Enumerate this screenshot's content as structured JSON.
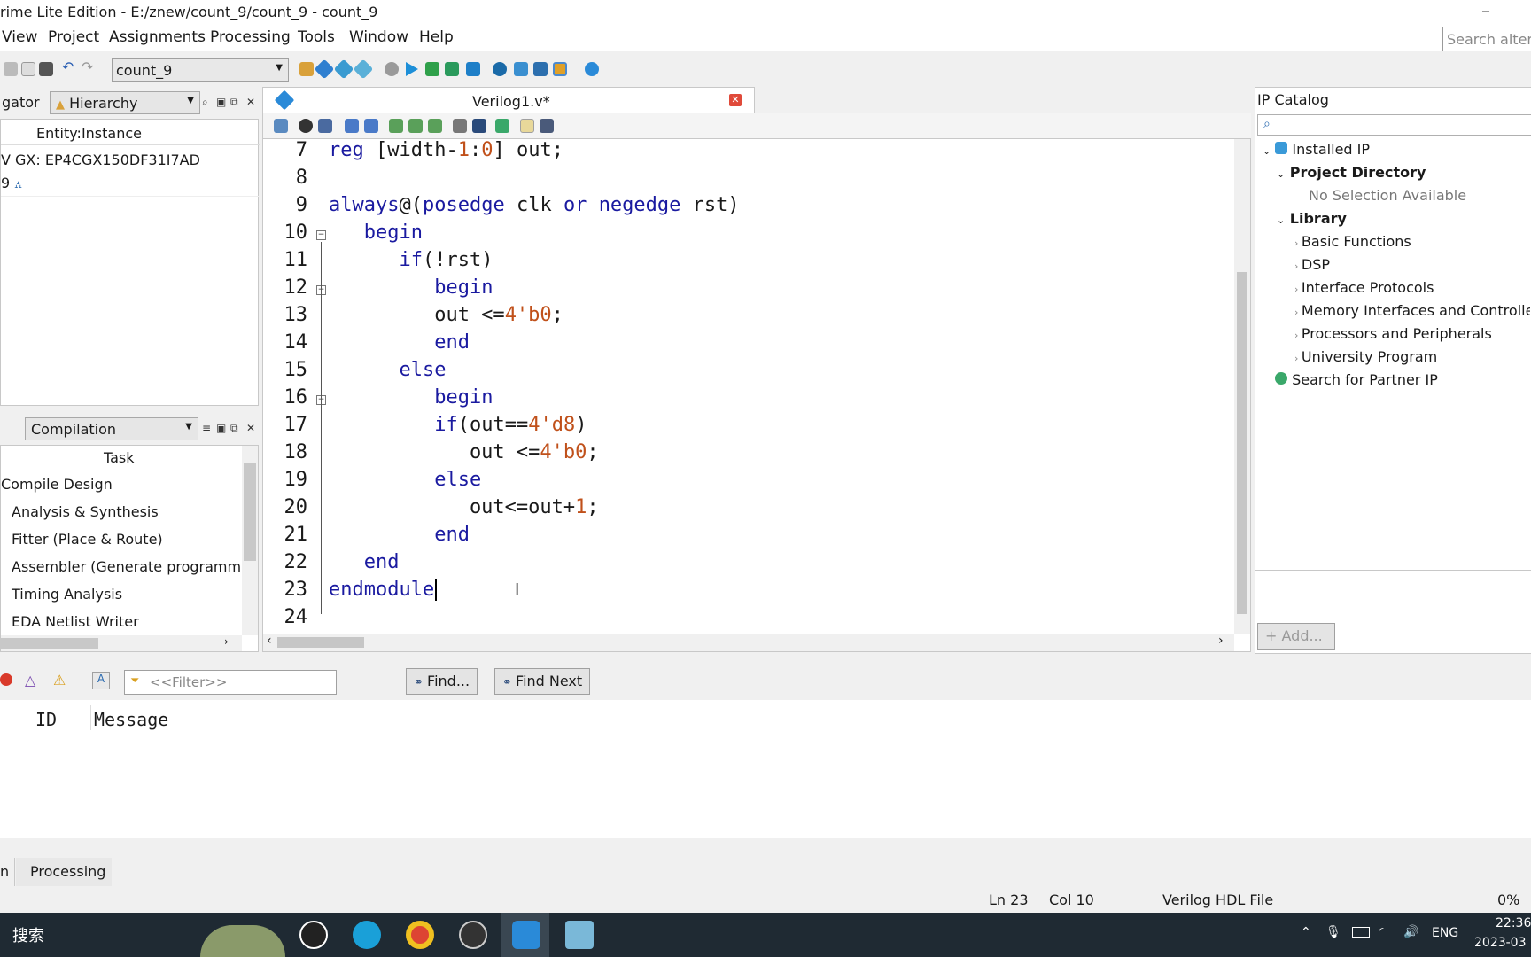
{
  "window": {
    "title": "rime Lite Edition - E:/znew/count_9/count_9 - count_9",
    "minimize_glyph": "–"
  },
  "menu": {
    "items": [
      "View",
      "Project",
      "Assignments",
      "Processing",
      "Tools",
      "Window",
      "Help"
    ]
  },
  "search": {
    "placeholder": "Search altera"
  },
  "toolbar": {
    "project": "count_9"
  },
  "navigator": {
    "tab_label": "gator",
    "view": "Hierarchy",
    "column_header": "Entity:Instance",
    "device": "V GX: EP4CGX150DF31I7AD",
    "entity": "9"
  },
  "tasks": {
    "flow": "Compilation",
    "column_header": "Task",
    "items": [
      "Compile Design",
      "Analysis & Synthesis",
      "Fitter (Place & Route)",
      "Assembler (Generate programmin",
      "Timing Analysis",
      "EDA Netlist Writer"
    ]
  },
  "editor": {
    "tab": "Verilog1.v*",
    "lines": [
      "7",
      "8",
      "9",
      "10",
      "11",
      "12",
      "13",
      "14",
      "15",
      "16",
      "17",
      "18",
      "19",
      "20",
      "21",
      "22",
      "23",
      "24"
    ]
  },
  "ip_catalog": {
    "title": "IP Catalog",
    "installed": "Installed IP",
    "project_dir": "Project Directory",
    "no_selection": "No Selection Available",
    "library": "Library",
    "library_items": [
      "Basic Functions",
      "DSP",
      "Interface Protocols",
      "Memory Interfaces and Controllers",
      "Processors and Peripherals",
      "University Program"
    ],
    "partner": "Search for Partner IP",
    "add_button": "+ Add..."
  },
  "messages": {
    "filter_placeholder": "<<Filter>>",
    "find": "Find...",
    "find_next": "Find Next",
    "col_id": "ID",
    "col_message": "Message"
  },
  "bottom_tabs": {
    "left": "n",
    "processing": "Processing"
  },
  "status": {
    "line": "Ln 23",
    "col": "Col 10",
    "file_type": "Verilog HDL File",
    "progress": "0%"
  },
  "taskbar": {
    "search": "搜索",
    "lang": "ENG",
    "time": "22:36",
    "date": "2023-03"
  }
}
